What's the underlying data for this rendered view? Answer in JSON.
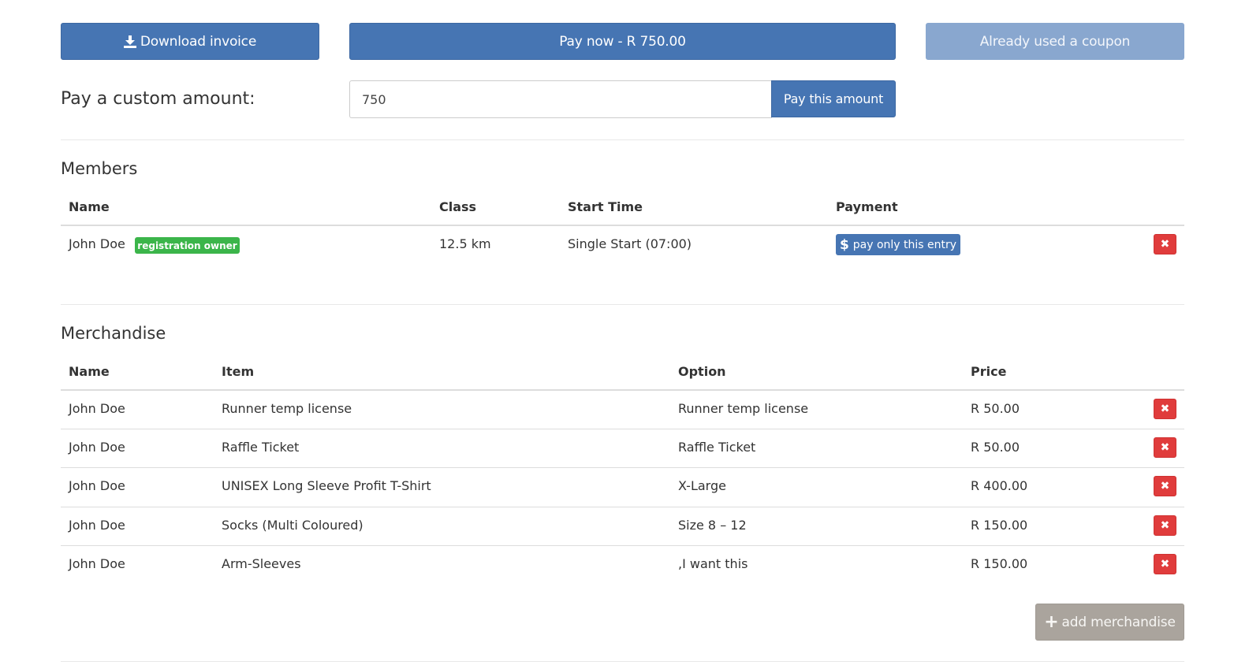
{
  "actions": {
    "download_invoice": "Download invoice",
    "pay_now": "Pay now - R 750.00",
    "coupon": "Already used a coupon"
  },
  "custom_amount": {
    "label": "Pay a custom amount:",
    "value": "750",
    "button": "Pay this amount"
  },
  "members": {
    "title": "Members",
    "headers": {
      "name": "Name",
      "class": "Class",
      "start_time": "Start Time",
      "payment": "Payment"
    },
    "rows": [
      {
        "name": "John Doe",
        "badge": "registration owner",
        "class": "12.5 km",
        "start_time": "Single Start (07:00)",
        "payment_label": "pay only this entry",
        "payment_icon": "$"
      }
    ]
  },
  "merchandise": {
    "title": "Merchandise",
    "headers": {
      "name": "Name",
      "item": "Item",
      "option": "Option",
      "price": "Price"
    },
    "rows": [
      {
        "name": "John Doe",
        "item": "Runner temp license",
        "option": "Runner temp license",
        "price": "R 50.00"
      },
      {
        "name": "John Doe",
        "item": "Raffle Ticket",
        "option": "Raffle Ticket",
        "price": "R 50.00"
      },
      {
        "name": "John Doe",
        "item": "UNISEX Long Sleeve Profit T-Shirt",
        "option": "X-Large",
        "price": "R 400.00"
      },
      {
        "name": "John Doe",
        "item": "Socks (Multi Coloured)",
        "option": "Size 8 – 12",
        "price": "R 150.00"
      },
      {
        "name": "John Doe",
        "item": "Arm-Sleeves",
        "option": ",I want this",
        "price": "R 150.00"
      }
    ],
    "add_button": "add merchandise"
  },
  "colors": {
    "primary": "#4675b3",
    "disabled": "#89a7cf",
    "danger": "#e03c3c",
    "success": "#3bb54a",
    "neutral": "#aaa49d"
  },
  "icons": {
    "download": "download-icon",
    "dollar": "dollar-icon",
    "remove": "times-icon",
    "add": "plus-icon"
  }
}
